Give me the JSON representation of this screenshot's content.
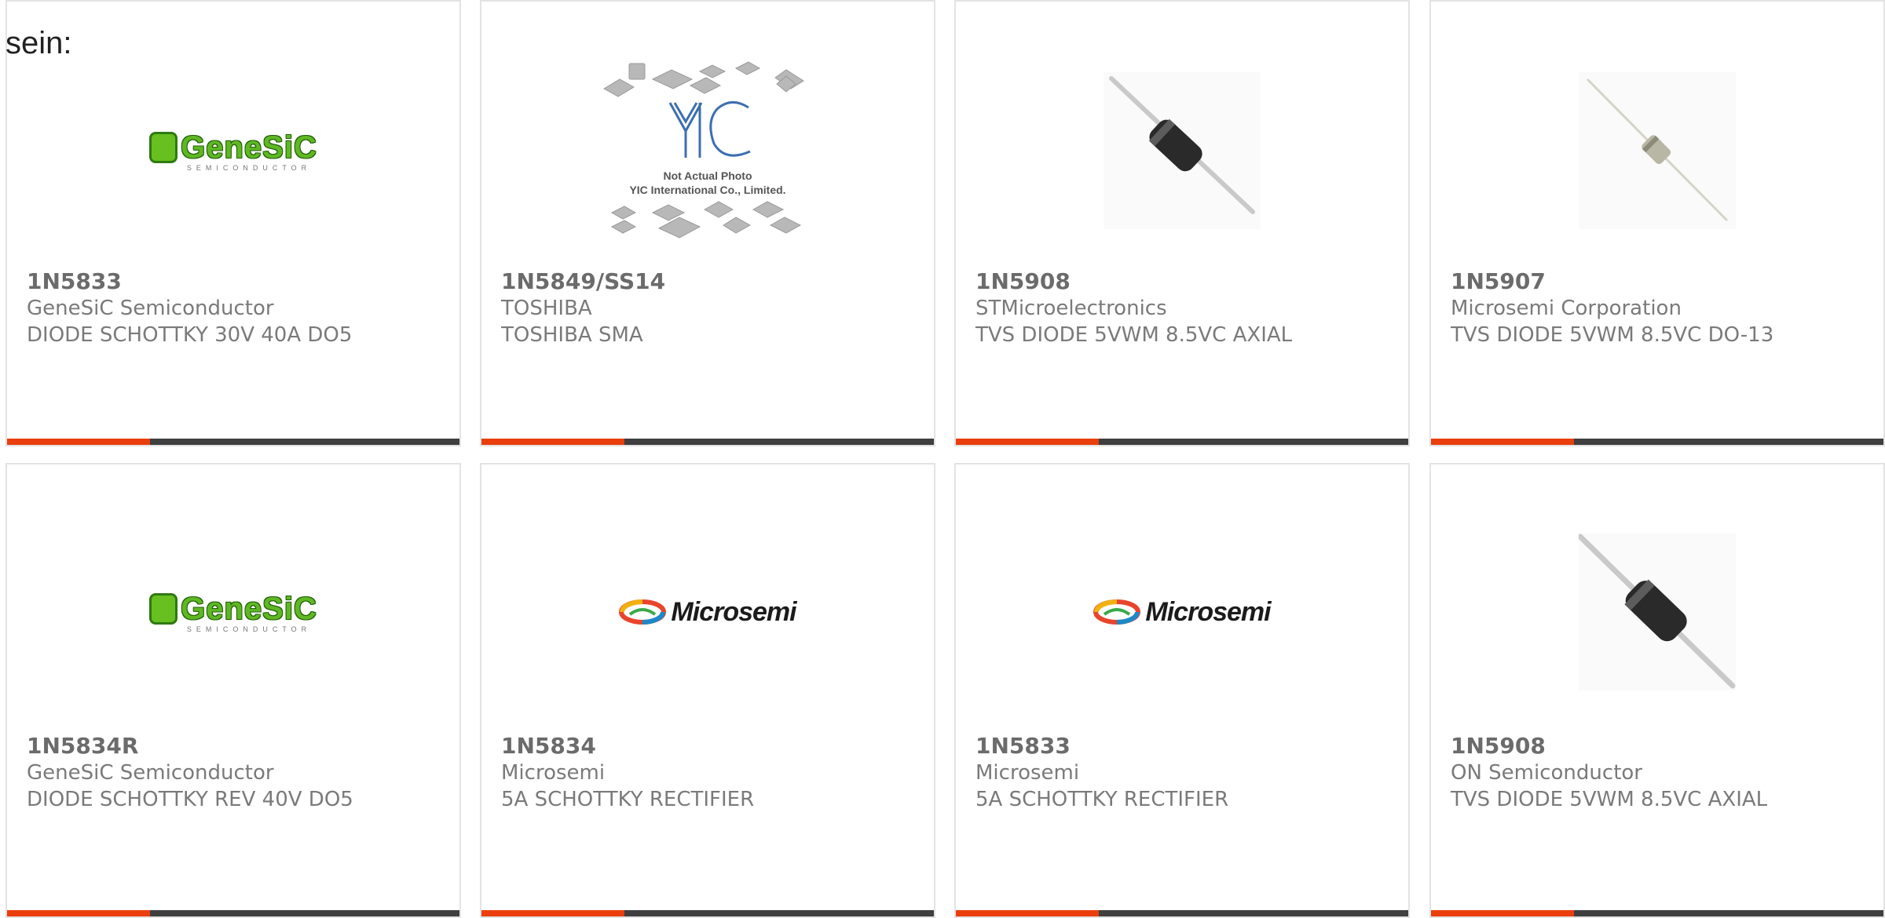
{
  "intro_text": "sein:",
  "accent_color": "#ea3f0d",
  "bar_color": "#3f3f3f",
  "yic_caption": {
    "line1": "Not Actual Photo",
    "line2": "YIC International Co., Limited."
  },
  "logo_text": {
    "genesic": "GeneSiC",
    "genesic_sub": "SEMICONDUCTOR",
    "microsemi": "Microsemi"
  },
  "products": [
    {
      "part": "1N5833",
      "manufacturer": "GeneSiC Semiconductor",
      "description": "DIODE SCHOTTKY 30V 40A DO5",
      "image": "genesic-logo"
    },
    {
      "part": "1N5849/SS14",
      "manufacturer": "TOSHIBA",
      "description": "TOSHIBA SMA",
      "image": "yic-placeholder"
    },
    {
      "part": "1N5908",
      "manufacturer": "STMicroelectronics",
      "description": "TVS DIODE 5VWM 8.5VC AXIAL",
      "image": "axial-diode"
    },
    {
      "part": "1N5907",
      "manufacturer": "Microsemi Corporation",
      "description": "TVS DIODE 5VWM 8.5VC DO-13",
      "image": "axial-diode-small"
    },
    {
      "part": "1N5834R",
      "manufacturer": "GeneSiC Semiconductor",
      "description": "DIODE SCHOTTKY REV 40V DO5",
      "image": "genesic-logo"
    },
    {
      "part": "1N5834",
      "manufacturer": "Microsemi",
      "description": "5A SCHOTTKY RECTIFIER",
      "image": "microsemi-logo"
    },
    {
      "part": "1N5833",
      "manufacturer": "Microsemi",
      "description": "5A SCHOTTKY RECTIFIER",
      "image": "microsemi-logo"
    },
    {
      "part": "1N5908",
      "manufacturer": "ON Semiconductor",
      "description": "TVS DIODE 5VWM 8.5VC AXIAL",
      "image": "axial-diode"
    }
  ]
}
